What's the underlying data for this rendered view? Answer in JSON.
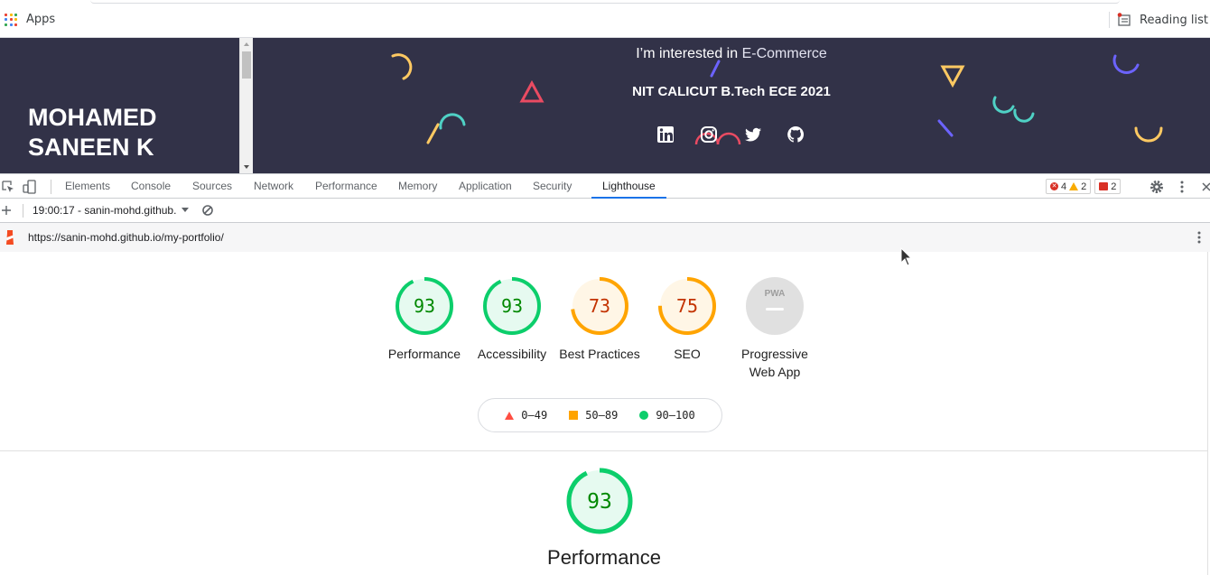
{
  "bookmarks": {
    "apps_label": "Apps",
    "reading_list_label": "Reading list",
    "apps_colors": [
      "#ea4335",
      "#fbbc04",
      "#34a853",
      "#4285f4",
      "#ea4335",
      "#fbbc04",
      "#34a853",
      "#4285f4",
      "#ea4335"
    ]
  },
  "site": {
    "name_line1": "MOHAMED",
    "name_line2": "SANEEN K",
    "interest_prefix": "I’m interested in ",
    "interest_highlight": "E-Commerce",
    "degree": "NIT CALICUT B.Tech ECE 2021",
    "socials": [
      "linkedin-icon",
      "instagram-icon",
      "twitter-icon",
      "github-icon"
    ],
    "background_color": "#323248"
  },
  "devtools": {
    "tabs": [
      "Elements",
      "Console",
      "Sources",
      "Network",
      "Performance",
      "Memory",
      "Application",
      "Security",
      "Lighthouse"
    ],
    "active_tab": "Lighthouse",
    "errors": "4",
    "warnings": "2",
    "issues": "2"
  },
  "lighthouse": {
    "report_selector": "19:00:17 - sanin-mohd.github.",
    "url": "https://sanin-mohd.github.io/my-portfolio/",
    "categories": [
      {
        "score": "93",
        "label": "Performance",
        "color": "#0cce6b"
      },
      {
        "score": "93",
        "label": "Accessibility",
        "color": "#0cce6b"
      },
      {
        "score": "73",
        "label": "Best Practices",
        "color": "#ffa400"
      },
      {
        "score": "75",
        "label": "SEO",
        "color": "#ffa400"
      },
      {
        "score": "",
        "label": "Progressive Web App",
        "color": "#bdbdbd",
        "badge": "PWA"
      }
    ],
    "legend": {
      "fail": "0–49",
      "average": "50–89",
      "pass": "90–100"
    },
    "section": {
      "score": "93",
      "title": "Performance"
    }
  }
}
